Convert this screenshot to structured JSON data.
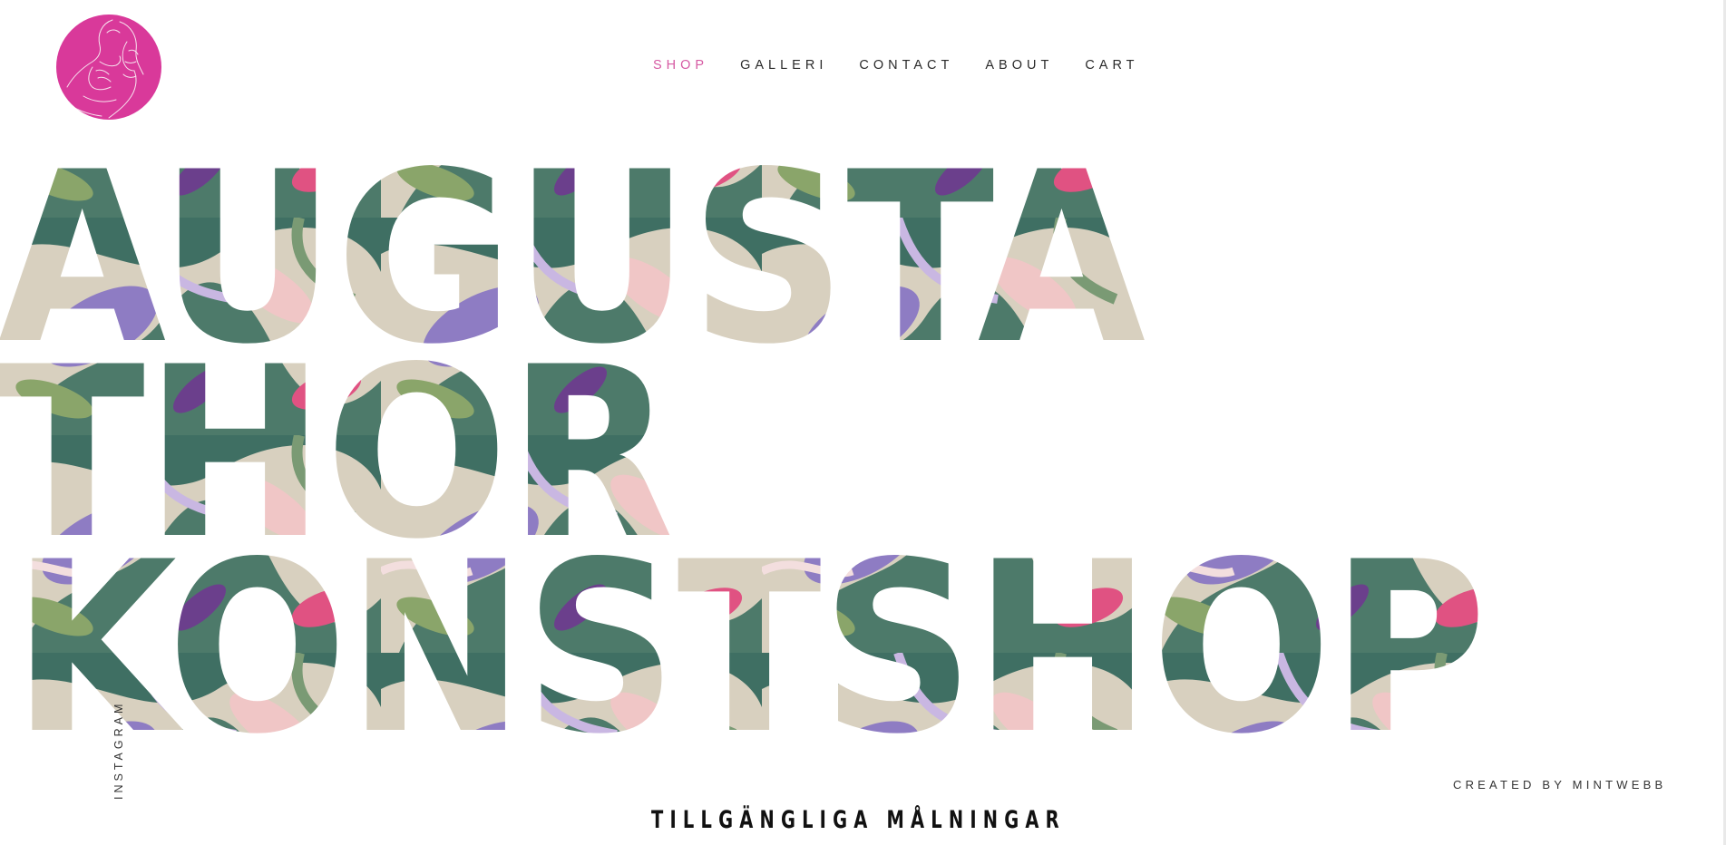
{
  "logo": {
    "icon": "woman-face-line-art-icon",
    "color": "#d9399a"
  },
  "nav": {
    "items": [
      {
        "label": "SHOP",
        "active": true
      },
      {
        "label": "GALLERI",
        "active": false
      },
      {
        "label": "CONTACT",
        "active": false
      },
      {
        "label": "ABOUT",
        "active": false
      },
      {
        "label": "CART",
        "active": false
      }
    ],
    "active_color": "#d65aa3"
  },
  "hero": {
    "lines": [
      "AUGUSTA",
      "THOR",
      "KONSTSHOP"
    ],
    "fill": "painted-floral-texture",
    "colors": [
      "#3f6f63",
      "#8e7cc3",
      "#f0c6c6",
      "#8aa56a",
      "#e05282",
      "#6b3f8c",
      "#d8d0bf"
    ]
  },
  "social": {
    "instagram_label": "INSTAGRAM"
  },
  "footer": {
    "credit": "CREATED BY MINTWEBB"
  },
  "section": {
    "heading": "TILLGÄNGLIGA MÅLNINGAR"
  }
}
